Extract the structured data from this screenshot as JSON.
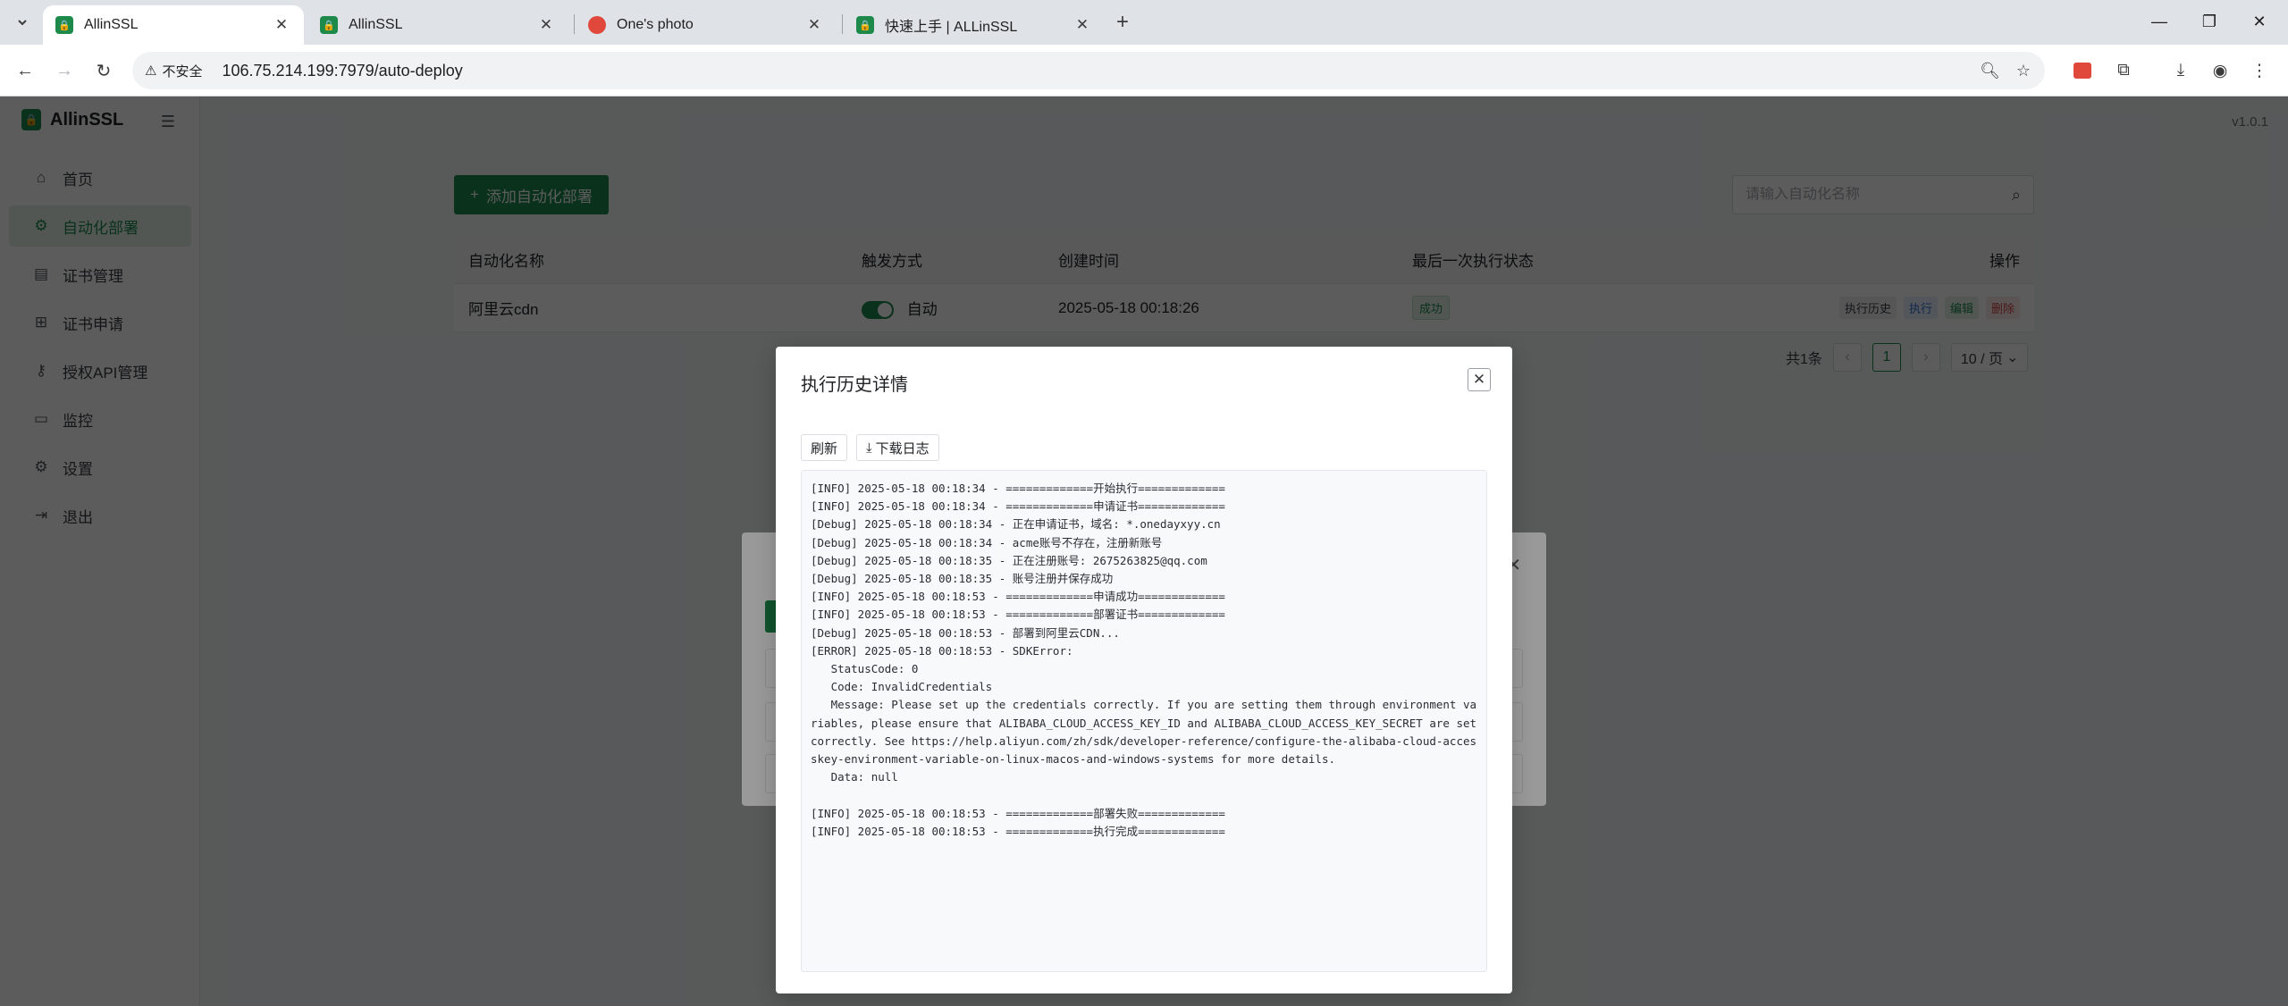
{
  "browser": {
    "tabs": [
      {
        "title": "AllinSSL",
        "active": true,
        "icon": "allinssl-favicon"
      },
      {
        "title": "AllinSSL",
        "active": false,
        "icon": "allinssl-favicon"
      },
      {
        "title": "One's photo",
        "active": false,
        "icon": "photo-favicon"
      },
      {
        "title": "快速上手 | ALLinSSL",
        "active": false,
        "icon": "allinssl-favicon"
      }
    ],
    "security_label": "不安全",
    "url": "106.75.214.199:7979/auto-deploy"
  },
  "sidebar": {
    "brand": "AllinSSL",
    "items": [
      {
        "label": "首页",
        "icon": "home-icon"
      },
      {
        "label": "自动化部署",
        "icon": "deploy-icon"
      },
      {
        "label": "证书管理",
        "icon": "certificate-icon"
      },
      {
        "label": "证书申请",
        "icon": "apply-icon"
      },
      {
        "label": "授权API管理",
        "icon": "api-key-icon"
      },
      {
        "label": "监控",
        "icon": "monitor-icon"
      },
      {
        "label": "设置",
        "icon": "gear-icon"
      },
      {
        "label": "退出",
        "icon": "logout-icon"
      }
    ]
  },
  "header": {
    "version": "v1.0.1"
  },
  "main": {
    "add_button": "添加自动化部署",
    "search_placeholder": "请输入自动化名称",
    "columns": [
      "自动化名称",
      "触发方式",
      "创建时间",
      "最后一次执行状态",
      "操作"
    ],
    "rows": [
      {
        "name": "阿里云cdn",
        "trigger": "自动",
        "created": "2025-05-18 00:18:26",
        "status": "成功",
        "actions": [
          "执行历史",
          "执行",
          "编辑",
          "删除"
        ]
      }
    ],
    "pagination": {
      "total": "共1条",
      "current_page": "1",
      "page_size": "10 / 页"
    }
  },
  "modal": {
    "title": "执行历史详情",
    "refresh_button": "刷新",
    "download_button": "下载日志",
    "log": "[INFO] 2025-05-18 00:18:34 - =============开始执行=============\n[INFO] 2025-05-18 00:18:34 - =============申请证书=============\n[Debug] 2025-05-18 00:18:34 - 正在申请证书，域名: *.onedayxyy.cn\n[Debug] 2025-05-18 00:18:34 - acme账号不存在，注册新账号\n[Debug] 2025-05-18 00:18:35 - 正在注册账号: 2675263825@qq.com\n[Debug] 2025-05-18 00:18:35 - 账号注册并保存成功\n[INFO] 2025-05-18 00:18:53 - =============申请成功=============\n[INFO] 2025-05-18 00:18:53 - =============部署证书=============\n[Debug] 2025-05-18 00:18:53 - 部署到阿里云CDN...\n[ERROR] 2025-05-18 00:18:53 - SDKError:\n   StatusCode: 0\n   Code: InvalidCredentials\n   Message: Please set up the credentials correctly. If you are setting them through environment variables, please ensure that ALIBABA_CLOUD_ACCESS_KEY_ID and ALIBABA_CLOUD_ACCESS_KEY_SECRET are set correctly. See https://help.aliyun.com/zh/sdk/developer-reference/configure-the-alibaba-cloud-accesskey-environment-variable-on-linux-macos-and-windows-systems for more details.\n   Data: null\n\n[INFO] 2025-05-18 00:18:53 - =============部署失败=============\n[INFO] 2025-05-18 00:18:53 - =============执行完成============="
  },
  "colors": {
    "brand_green": "#1d8a4c",
    "error_red": "#d64545",
    "info_blue": "#2f6fd6"
  }
}
